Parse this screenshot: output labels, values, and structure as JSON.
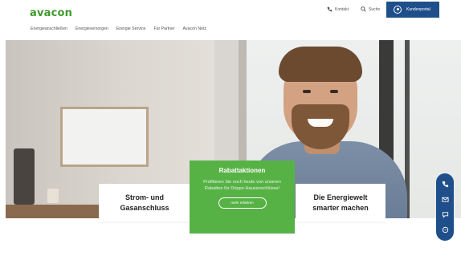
{
  "brand": {
    "logo_text": "avacon",
    "logo_color": "#3e9a2c",
    "accent_blue": "#1f4f8b",
    "accent_green": "#57b246"
  },
  "utility": {
    "contact_label": "Kontakt",
    "contact_icon": "phone-icon",
    "search_label": "Suche",
    "search_icon": "search-icon",
    "login_label": "Kundenportal",
    "login_icon": "user-icon"
  },
  "nav": {
    "items": [
      {
        "label": "Energieanschließen"
      },
      {
        "label": "Energieversorgen"
      },
      {
        "label": "Energie Service"
      },
      {
        "label": "Für Partner"
      },
      {
        "label": "Avacon Netz"
      }
    ]
  },
  "hero": {
    "card_left": "Strom- und Gasanschluss",
    "card_right": "Die Energiewelt smarter machen",
    "promo": {
      "title": "Rabattaktionen",
      "text": "Profitieren Sie noch heute von unseren Rabatten für Drippe-Hausanschlüsse!",
      "button": "mehr erfahren"
    }
  },
  "side_contact": {
    "icons": [
      "phone-icon",
      "mail-icon",
      "chat-icon",
      "message-icon"
    ]
  }
}
